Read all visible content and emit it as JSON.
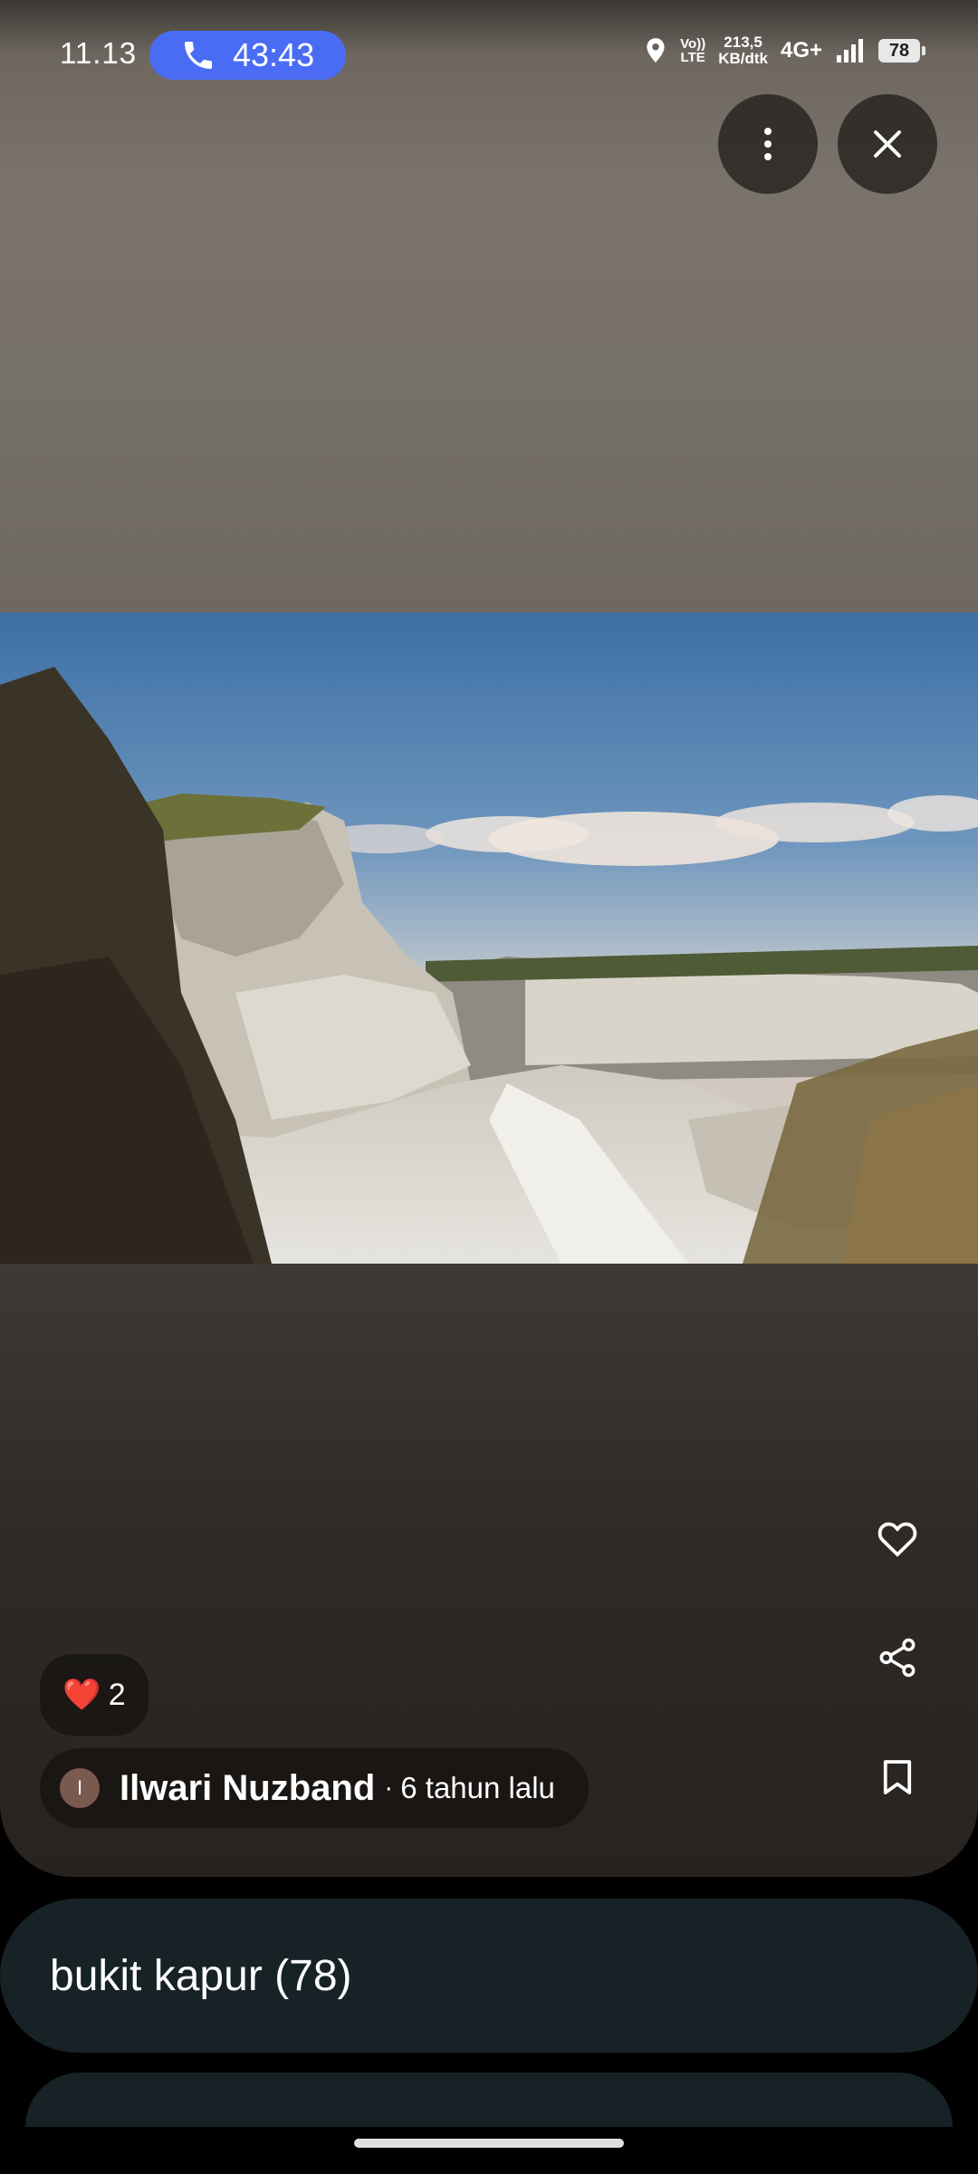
{
  "status_bar": {
    "time": "11.13",
    "call_duration": "43:43",
    "volte_top": "Vo))",
    "volte_bottom": "LTE",
    "speed_value": "213,5",
    "speed_unit": "KB/dtk",
    "network": "4G+",
    "battery": "78"
  },
  "top_actions": {
    "more_icon": "more-vertical-icon",
    "close_icon": "close-icon"
  },
  "photo": {
    "subject": "limestone quarry cliffs under blue sky"
  },
  "side_actions": [
    {
      "icon": "heart-outline-icon"
    },
    {
      "icon": "share-icon"
    },
    {
      "icon": "bookmark-icon"
    }
  ],
  "likes": {
    "emoji": "❤️",
    "count": "2"
  },
  "author": {
    "initial": "I",
    "name": "Ilwari Nuzband",
    "separator": "·",
    "age": "6 tahun lalu"
  },
  "album": {
    "title": "bukit kapur (78)"
  },
  "colors": {
    "call_pill": "#4a6cf5",
    "album_bar": "#172226"
  }
}
